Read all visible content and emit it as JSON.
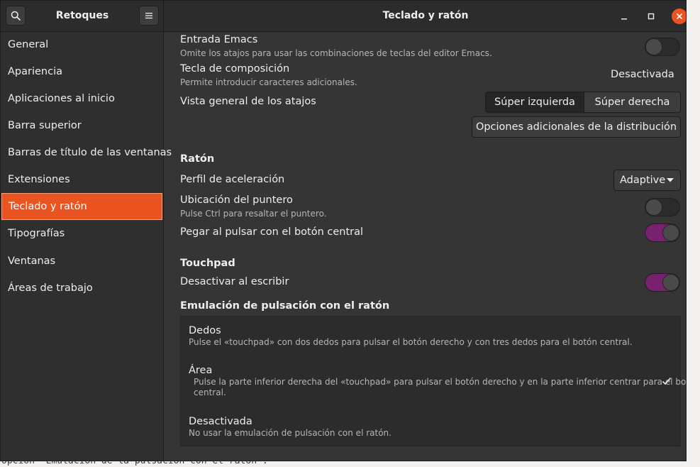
{
  "background_caption": "opción \"Emulación de la pulsación con el ratón\".",
  "header": {
    "app_title": "Retoques",
    "window_title": "Teclado y ratón"
  },
  "sidebar": {
    "items": [
      {
        "label": "General"
      },
      {
        "label": "Apariencia"
      },
      {
        "label": "Aplicaciones al inicio"
      },
      {
        "label": "Barra superior"
      },
      {
        "label": "Barras de título de las ventanas"
      },
      {
        "label": "Extensiones"
      },
      {
        "label": "Teclado y ratón",
        "active": true
      },
      {
        "label": "Tipografías"
      },
      {
        "label": "Ventanas"
      },
      {
        "label": "Áreas de trabajo"
      }
    ]
  },
  "keyboard": {
    "emacs": {
      "title": "Entrada Emacs",
      "subtitle": "Omite los atajos para usar las combinaciones de teclas del editor Emacs.",
      "enabled": false
    },
    "compose": {
      "title": "Tecla de composición",
      "subtitle": "Permite introducir caracteres adicionales.",
      "value": "Desactivada"
    },
    "overview": {
      "title": "Vista general de los atajos",
      "left_label": "Súper izquierda",
      "right_label": "Súper derecha",
      "selected": "Súper izquierda"
    },
    "layout_button": "Opciones adicionales de la distribución"
  },
  "mouse": {
    "section": "Ratón",
    "accel": {
      "title": "Perfil de aceleración",
      "value": "Adaptive"
    },
    "pointer": {
      "title": "Ubicación del puntero",
      "subtitle": "Pulse Ctrl para resaltar el puntero.",
      "enabled": false
    },
    "middle_paste": {
      "title": "Pegar al pulsar con el botón central",
      "enabled": true
    }
  },
  "touchpad": {
    "section": "Touchpad",
    "disable_typing": {
      "title": "Desactivar al escribir",
      "enabled": true
    }
  },
  "click_emulation": {
    "section": "Emulación de pulsación con el ratón",
    "options": [
      {
        "title": "Dedos",
        "subtitle": "Pulse el «touchpad» con dos dedos para pulsar el botón derecho y con tres dedos para el botón central.",
        "selected": false
      },
      {
        "title": "Área",
        "subtitle_line1": "Pulse la parte inferior derecha del «touchpad» para pulsar el botón derecho y en la parte inferior centrar para el botón",
        "subtitle_line2": "central.",
        "selected": true
      },
      {
        "title": "Desactivada",
        "subtitle": "No usar la emulación de pulsación con el ratón.",
        "selected": false
      }
    ]
  },
  "colors": {
    "accent": "#e95420",
    "switch_on": "#77216f"
  }
}
